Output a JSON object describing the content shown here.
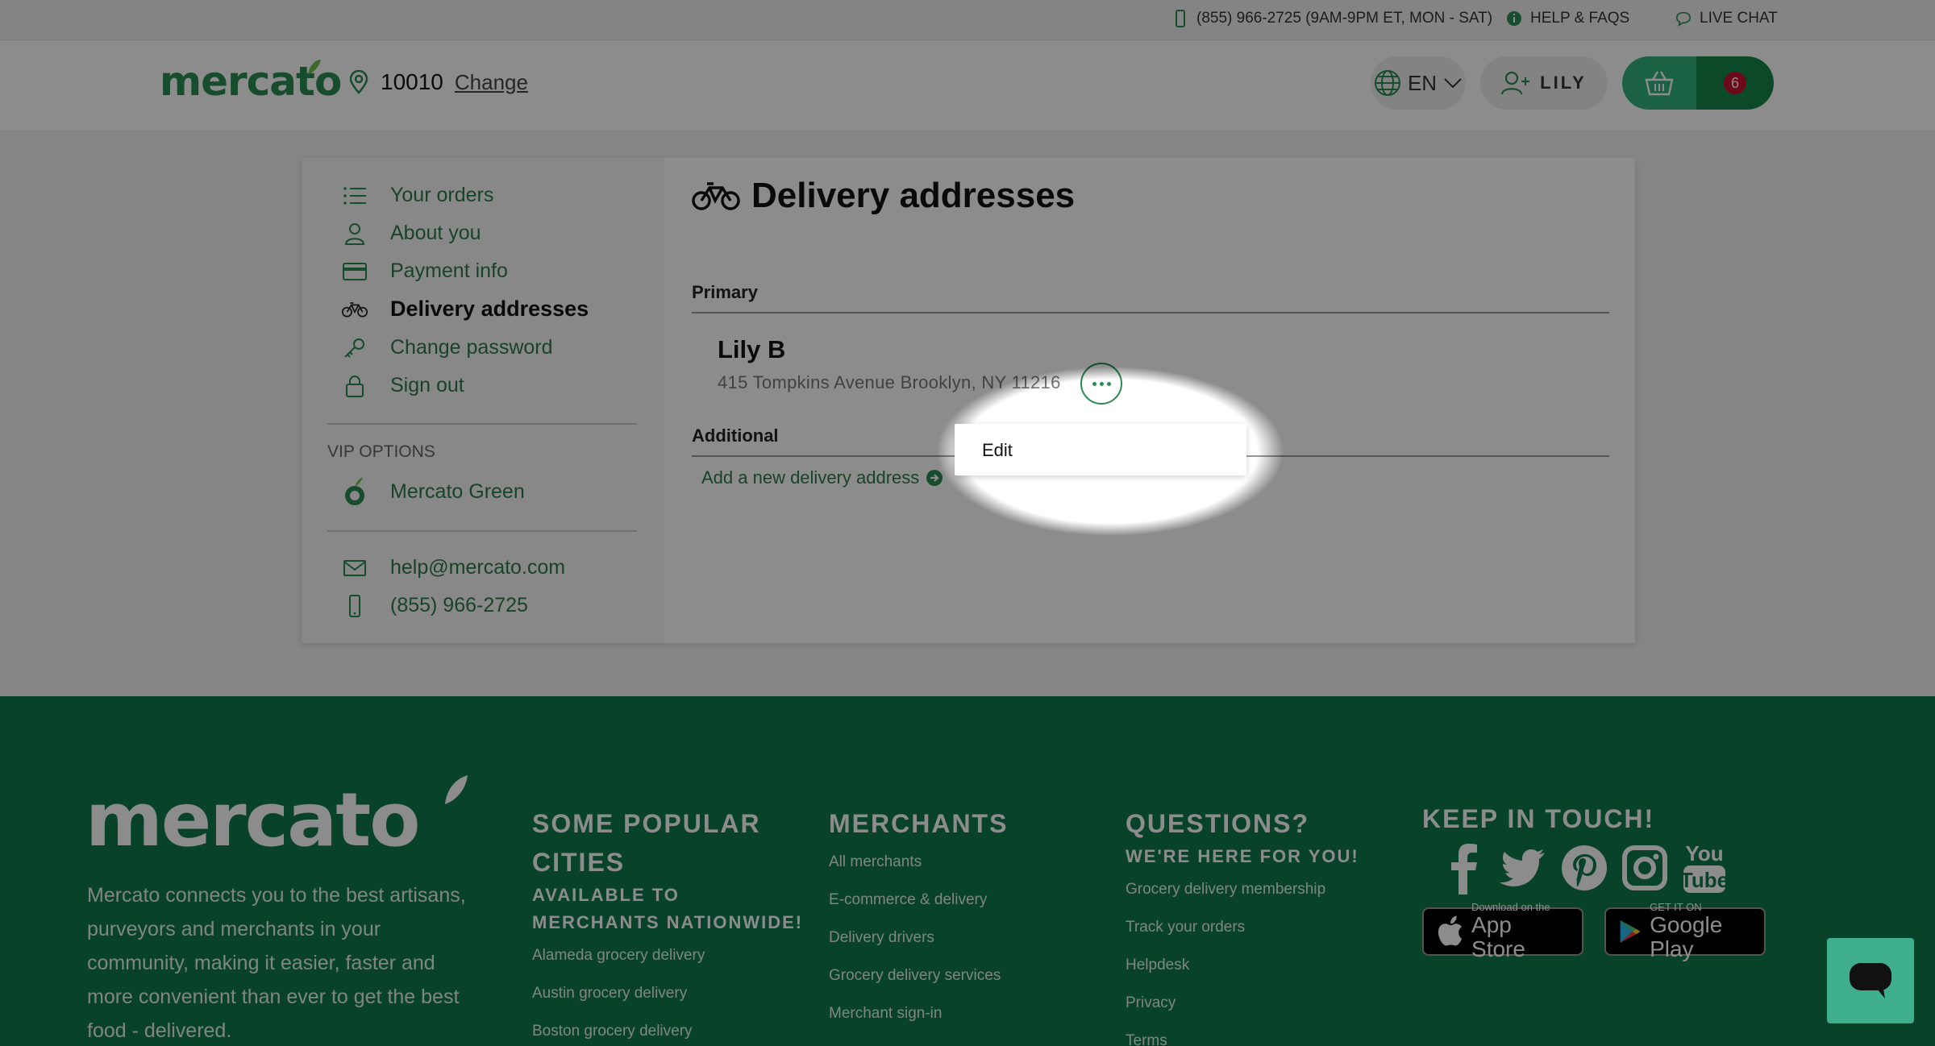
{
  "topbar": {
    "phone": "(855) 966-2725 (9AM-9PM ET, MON - SAT)",
    "help": "HELP & FAQS",
    "chat": "LIVE CHAT"
  },
  "header": {
    "logo": "mercato",
    "zip": "10010",
    "change": "Change",
    "lang": "EN",
    "user": "LILY",
    "cart_count": "6"
  },
  "sidebar": {
    "items": [
      {
        "label": "Your orders",
        "icon": "list-icon"
      },
      {
        "label": "About you",
        "icon": "user-icon"
      },
      {
        "label": "Payment info",
        "icon": "card-icon"
      },
      {
        "label": "Delivery addresses",
        "icon": "bike-icon"
      },
      {
        "label": "Change password",
        "icon": "key-icon"
      },
      {
        "label": "Sign out",
        "icon": "lock-icon"
      }
    ],
    "vip_label": "VIP OPTIONS",
    "vip_item": "Mercato Green",
    "email": "help@mercato.com",
    "phone": "(855) 966-2725"
  },
  "main": {
    "title": "Delivery addresses",
    "primary_label": "Primary",
    "address_name": "Lily B",
    "address_line": "415 Tompkins Avenue Brooklyn, NY 11216",
    "additional_label": "Additional",
    "add_link": "Add a new delivery address",
    "menu_edit": "Edit"
  },
  "footer": {
    "logo": "mercato",
    "description": "Mercato connects you to the best artisans, purveyors and merchants in your community, making it easier, faster and more convenient than ever to get the best food - delivered.",
    "cities": {
      "heading": "SOME POPULAR CITIES",
      "sub": "AVAILABLE TO MERCHANTS NATIONWIDE!",
      "links": [
        "Alameda grocery delivery",
        "Austin grocery delivery",
        "Boston grocery delivery"
      ]
    },
    "merchants": {
      "heading": "MERCHANTS",
      "links": [
        "All merchants",
        "E-commerce & delivery",
        "Delivery drivers",
        "Grocery delivery services",
        "Merchant sign-in"
      ]
    },
    "questions": {
      "heading": "QUESTIONS?",
      "sub": "WE'RE HERE FOR YOU!",
      "links": [
        "Grocery delivery membership",
        "Track your orders",
        "Helpdesk",
        "Privacy",
        "Terms"
      ]
    },
    "touch": {
      "heading": "KEEP IN TOUCH!",
      "appstore_small": "Download on the",
      "appstore_big": "App Store",
      "gplay_small": "GET IT ON",
      "gplay_big": "Google Play"
    }
  },
  "colors": {
    "brand_green": "#2a8b52",
    "footer_green": "#0f7a4a",
    "cart_light": "#32b07a",
    "cart_dark": "#168548",
    "badge_red": "#c8102e"
  }
}
